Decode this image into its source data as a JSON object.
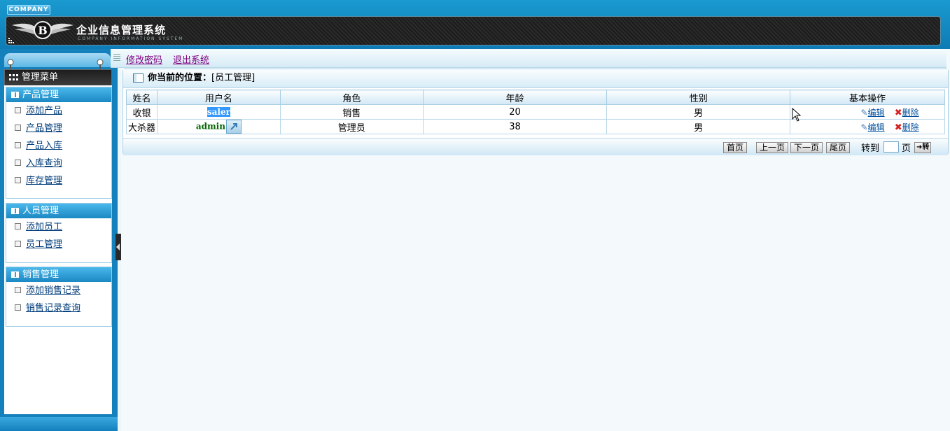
{
  "header": {
    "company_tag": "COMPANY",
    "logo_letter": "B",
    "title": "企业信息管理系统",
    "subtitle": "COMPANY INFORMATION SYSTEM"
  },
  "top_links": {
    "change_password": "修改密码",
    "logout": "退出系统"
  },
  "sidebar": {
    "menu_title": "管理菜单",
    "groups": [
      {
        "title": "产品管理",
        "items": [
          "添加产品",
          "产品管理",
          "产品入库",
          "入库查询",
          "库存管理"
        ]
      },
      {
        "title": "人员管理",
        "items": [
          "添加员工",
          "员工管理"
        ]
      },
      {
        "title": "销售管理",
        "items": [
          "添加销售记录",
          "销售记录查询"
        ]
      }
    ]
  },
  "breadcrumb": {
    "label": "你当前的位置：",
    "value": "[员工管理]"
  },
  "table": {
    "headers": [
      "姓名",
      "用户名",
      "角色",
      "年龄",
      "性别",
      "基本操作"
    ],
    "rows": [
      {
        "name": "收银",
        "username": "saler",
        "role": "销售",
        "age": "20",
        "gender": "男"
      },
      {
        "name": "大杀器",
        "username": "admin",
        "role": "管理员",
        "age": "38",
        "gender": "男"
      }
    ],
    "edit_label": "编辑",
    "delete_label": "删除"
  },
  "pager": {
    "first": "首页",
    "prev": "上一页",
    "next": "下一页",
    "last": "尾页",
    "goto_label": "转到",
    "page_unit": "页",
    "go_button": "➜转"
  },
  "colors": {
    "header_blue": "#1481bd",
    "link_visited": "#800080",
    "selection": "#3399ff",
    "delete_red": "#d42020"
  }
}
